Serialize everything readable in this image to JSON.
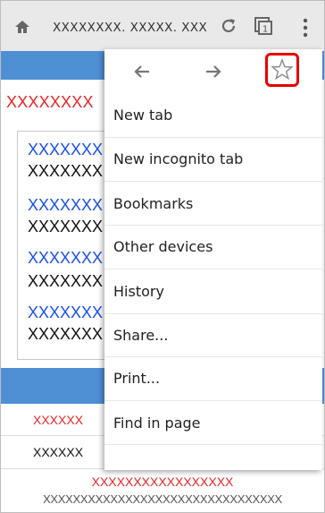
{
  "toolbar": {
    "url": "XXXXXXXX. XXXXX. XXX",
    "home_icon": "home-icon",
    "reload_icon": "reload-icon",
    "tabs_icon": "tab-switcher-icon",
    "tabs_count": "1",
    "menu_icon": "overflow-menu-icon"
  },
  "page": {
    "red_heading": "XXXXXXXX",
    "card_rows": [
      {
        "text": "XXXXXXX",
        "color": "blue"
      },
      {
        "text": "XXXXXXX",
        "color": "black"
      },
      {
        "text": "XXXXXXX",
        "color": "blue"
      },
      {
        "text": "XXXXXXX",
        "color": "black"
      },
      {
        "text": "XXXXXXX",
        "color": "blue"
      },
      {
        "text": "XXXXXXX",
        "color": "black"
      },
      {
        "text": "XXXXXXX",
        "color": "blue"
      },
      {
        "text": "XXXXXXX",
        "color": "black"
      }
    ],
    "small_red": "XXXXXX",
    "small_black": "XXXXXX",
    "footer_red": "XXXXXXXXXXXXXXXXX",
    "footer_black": "XXXXXXXXXXXXXXXXXXXXXXXXXXXXXXXX",
    "accent_blue": "#4f8fd4",
    "accent_red": "#e82525"
  },
  "menu": {
    "back_icon": "back-arrow-icon",
    "forward_icon": "forward-arrow-icon",
    "bookmark_icon": "star-icon",
    "highlight_color": "#e50000",
    "items": [
      "New tab",
      "New incognito tab",
      "Bookmarks",
      "Other devices",
      "History",
      "Share...",
      "Print...",
      "Find in page"
    ]
  }
}
